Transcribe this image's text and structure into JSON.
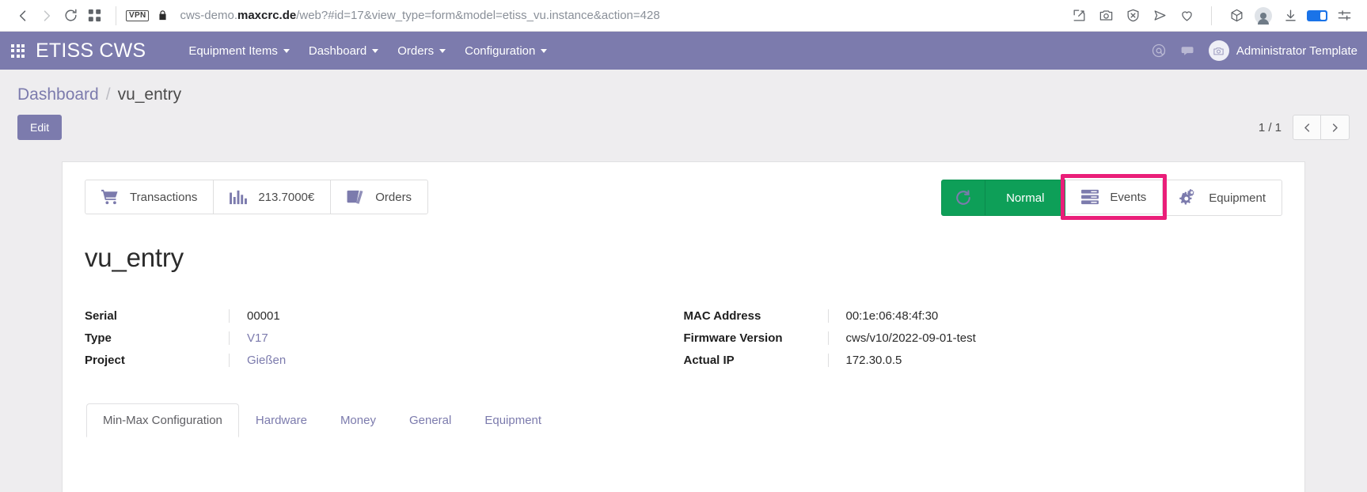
{
  "browser": {
    "back_icon": "chevron-left-icon",
    "forward_icon": "chevron-right-icon",
    "reload_icon": "reload-icon",
    "tabs_icon": "grid-tabs-icon",
    "vpn_label": "VPN",
    "lock_icon": "lock-icon",
    "url": "cws-demo.maxcrc.de/web?#id=17&view_type=form&model=etiss_vu.instance&action=428",
    "url_domain": "maxcrc.de",
    "url_prefix": "cws-demo.",
    "url_suffix": "/web?#id=17&view_type=form&model=etiss_vu.instance&action=428",
    "right_icons": [
      "annotate-icon",
      "screenshot-icon",
      "adblock-icon",
      "send-icon",
      "heart-icon",
      "cube-icon",
      "profile-avatar-icon",
      "downloads-icon",
      "battery-icon",
      "settings-sliders-icon"
    ]
  },
  "app_header": {
    "apps_menu_icon": "apps-grid-icon",
    "brand": "ETISS CWS",
    "menu": [
      {
        "label": "Equipment Items",
        "has_caret": true
      },
      {
        "label": "Dashboard",
        "has_caret": true
      },
      {
        "label": "Orders",
        "has_caret": true
      },
      {
        "label": "Configuration",
        "has_caret": true
      }
    ],
    "mentions_icon": "at-mention-icon",
    "messages_icon": "chat-bubble-icon",
    "avatar_icon": "user-avatar-icon",
    "user_name": "Administrator Template"
  },
  "control_panel": {
    "breadcrumb": {
      "parent": "Dashboard",
      "separator": "/",
      "current": "vu_entry"
    },
    "edit_label": "Edit",
    "pager_count": "1 / 1",
    "prev_icon": "chevron-left-icon",
    "next_icon": "chevron-right-icon"
  },
  "record": {
    "title": "vu_entry",
    "stat_buttons": [
      {
        "label": "Transactions",
        "icon": "shopping-cart-icon"
      },
      {
        "label": "213.7000€",
        "icon": "bar-chart-icon"
      },
      {
        "label": "Orders",
        "icon": "book-icon"
      }
    ],
    "status_button": {
      "label": "Normal",
      "icon": "refresh-icon",
      "color": "#0e9f58"
    },
    "action_buttons": [
      {
        "label": "Events",
        "icon": "server-list-icon",
        "highlighted": true
      },
      {
        "label": "Equipment",
        "icon": "cogs-icon",
        "highlighted": false
      }
    ],
    "highlight_color": "#ea1e79",
    "fields_left": [
      {
        "label": "Serial",
        "value": "00001",
        "is_link": false
      },
      {
        "label": "Type",
        "value": "V17",
        "is_link": true
      },
      {
        "label": "Project",
        "value": "Gießen",
        "is_link": true
      }
    ],
    "fields_right": [
      {
        "label": "MAC Address",
        "value": "00:1e:06:48:4f:30",
        "is_link": false
      },
      {
        "label": "Firmware Version",
        "value": "cws/v10/2022-09-01-test",
        "is_link": false
      },
      {
        "label": "Actual IP",
        "value": "172.30.0.5",
        "is_link": false
      }
    ],
    "tabs": [
      {
        "label": "Min-Max Configuration",
        "active": true
      },
      {
        "label": "Hardware",
        "active": false
      },
      {
        "label": "Money",
        "active": false
      },
      {
        "label": "General",
        "active": false
      },
      {
        "label": "Equipment",
        "active": false
      }
    ]
  }
}
